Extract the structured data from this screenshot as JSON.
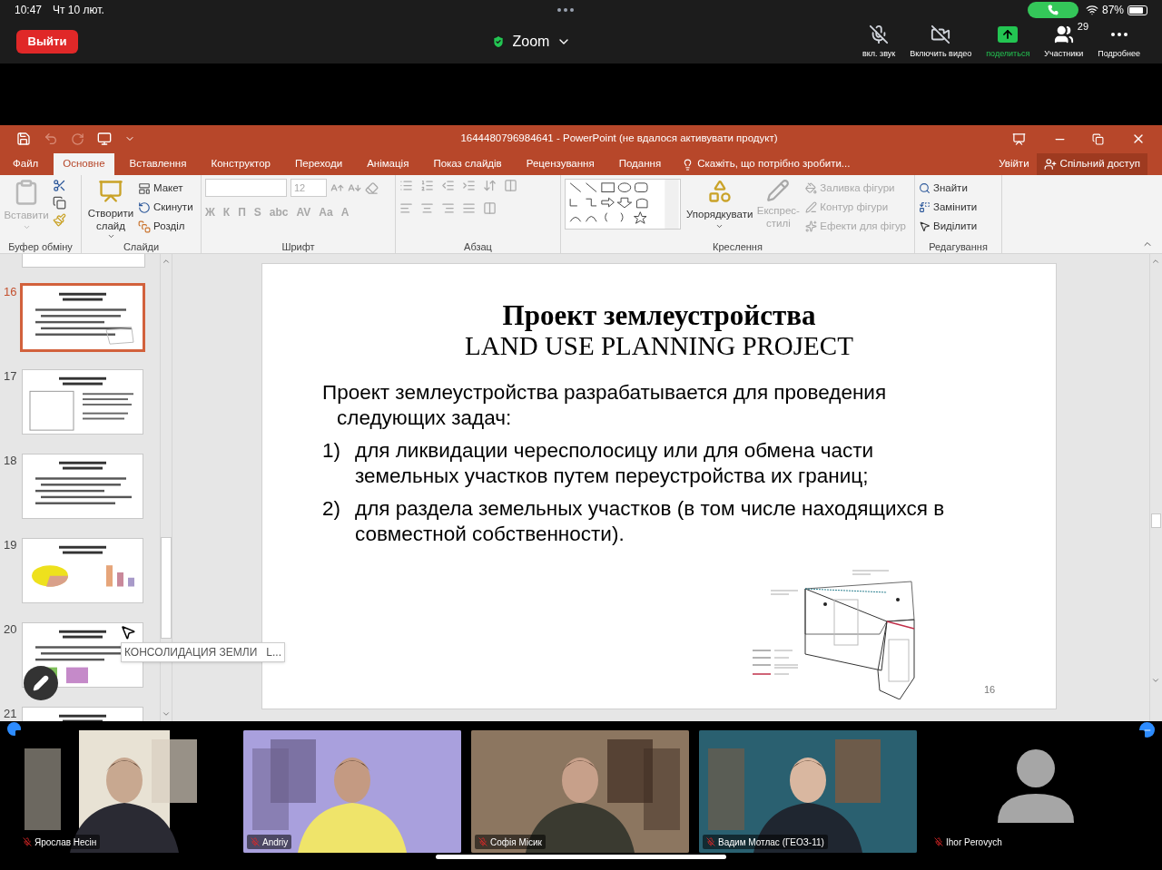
{
  "status_bar": {
    "time": "10:47",
    "date": "Чт 10 лют.",
    "battery": "87%"
  },
  "zoom_toolbar": {
    "leave_button": "Выйти",
    "title": "Zoom",
    "controls": [
      {
        "kind": "mic",
        "label": "вкл. звук",
        "active": false
      },
      {
        "kind": "video",
        "label": "Включить видео",
        "active": false
      },
      {
        "kind": "share",
        "label": "поделиться",
        "active": true
      },
      {
        "kind": "participants",
        "label": "Участники",
        "badge": "29"
      },
      {
        "kind": "more",
        "label": "Подробнее"
      }
    ]
  },
  "powerpoint": {
    "title": "1644480796984641 - PowerPoint (не вдалося активувати продукт)",
    "tabs": [
      {
        "label": "Файл",
        "selected": false
      },
      {
        "label": "Основне",
        "selected": true
      },
      {
        "label": "Вставлення",
        "selected": false
      },
      {
        "label": "Конструктор",
        "selected": false
      },
      {
        "label": "Переходи",
        "selected": false
      },
      {
        "label": "Анімація",
        "selected": false
      },
      {
        "label": "Показ слайдів",
        "selected": false
      },
      {
        "label": "Рецензування",
        "selected": false
      },
      {
        "label": "Подання",
        "selected": false
      }
    ],
    "tell_me": "Скажіть, що потрібно зробити...",
    "sign_in": "Увійти",
    "share": "Спільний доступ",
    "ribbon": [
      {
        "kind": "clipboard",
        "label": "Буфер обміну",
        "items": [
          {
            "label": "Вставити",
            "disabled": true
          }
        ]
      },
      {
        "kind": "slides",
        "label": "Слайди",
        "items": [
          {
            "label": "Створити слайд",
            "disabled": false
          },
          {
            "label": "Макет",
            "disabled": false
          },
          {
            "label": "Скинути",
            "disabled": false
          },
          {
            "label": "Розділ",
            "disabled": false
          }
        ]
      },
      {
        "kind": "font",
        "label": "Шрифт",
        "size": "12",
        "disabled": true,
        "format_buttons": [
          "Ж",
          "К",
          "П",
          "S",
          "abc",
          "AV",
          "Aa",
          "A"
        ]
      },
      {
        "kind": "paragraph",
        "label": "Абзац",
        "disabled": true
      },
      {
        "kind": "drawing",
        "label": "Креслення",
        "items": [
          {
            "label": "Упорядкувати",
            "disabled": false
          },
          {
            "label": "Експрес-стилі",
            "disabled": true
          },
          {
            "label": "Заливка фігури",
            "disabled": true
          },
          {
            "label": "Контур фігури",
            "disabled": true
          },
          {
            "label": "Ефекти для фігур",
            "disabled": true
          }
        ]
      },
      {
        "kind": "editing",
        "label": "Редагування",
        "items": [
          {
            "label": "Знайти",
            "disabled": false
          },
          {
            "label": "Замінити",
            "disabled": false
          },
          {
            "label": "Виділити",
            "disabled": false
          }
        ]
      }
    ],
    "thumbnails": [
      {
        "number": "16",
        "selected": true
      },
      {
        "number": "17",
        "selected": false
      },
      {
        "number": "18",
        "selected": false
      },
      {
        "number": "19",
        "selected": false
      },
      {
        "number": "20",
        "selected": false
      },
      {
        "number": "21",
        "selected": false
      }
    ],
    "tooltip": "КОНСОЛИДАЦИЯ ЗЕМЛИ   L...",
    "slide": {
      "title": "Проект землеустройства",
      "subtitle": "LAND USE PLANNING PROJECT",
      "intro": "Проект землеустройства  разрабатывается для проведения следующих задач:",
      "items": [
        {
          "marker": "1)",
          "text": "для ликвидации чересполосицу или для обмена части земельных участков путем переустройства  их границ;"
        },
        {
          "marker": "2)",
          "text": "для раздела земельных участков (в том числе находящихся в совместной собственности)."
        }
      ],
      "page_number": "16"
    }
  },
  "participants": [
    {
      "name": "Ярослав Несін",
      "muted": true,
      "kind": "video"
    },
    {
      "name": "Andriy",
      "muted": true,
      "kind": "video"
    },
    {
      "name": "Софія Місик",
      "muted": true,
      "kind": "video"
    },
    {
      "name": "Вадим Мотлас (ГЕОЗ-11)",
      "muted": true,
      "kind": "video"
    },
    {
      "name": "Ihor Perovych",
      "muted": true,
      "kind": "avatar"
    }
  ]
}
